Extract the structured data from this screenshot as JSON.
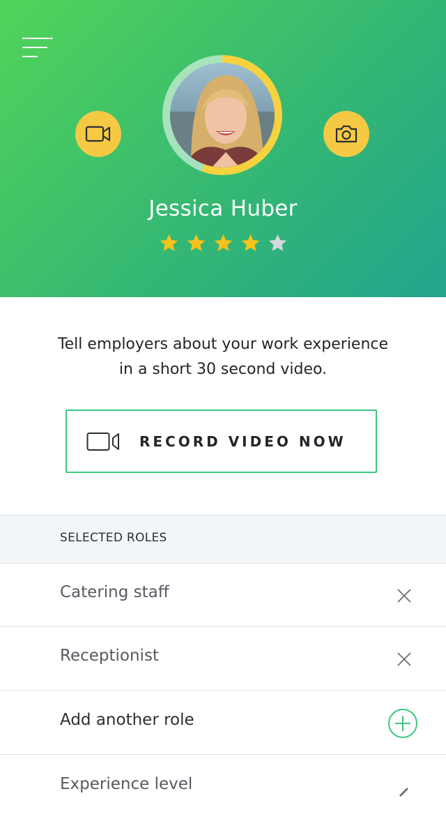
{
  "profile": {
    "name": "Jessica Huber",
    "rating": 4,
    "max_rating": 5
  },
  "icons": {
    "menu": "hamburger-menu-icon",
    "video": "video-camera-icon",
    "photo": "camera-icon",
    "remove": "close-icon",
    "add": "plus-circle-icon",
    "edit": "pencil-icon"
  },
  "colors": {
    "header_start": "#52d45a",
    "header_end": "#22a48e",
    "accent_yellow": "#f6c944",
    "accent_green": "#3cc77f",
    "star_filled": "#f6c21c",
    "star_empty": "#d5d9dd"
  },
  "intro": {
    "line1": "Tell employers about your work experience",
    "line2": "in a short 30 second video."
  },
  "record_button": {
    "label": "RECORD VIDEO NOW"
  },
  "roles": {
    "section_title": "SELECTED ROLES",
    "items": [
      {
        "label": "Catering staff"
      },
      {
        "label": "Receptionist"
      }
    ],
    "add_label": "Add another role"
  },
  "experience": {
    "label": "Experience level"
  }
}
